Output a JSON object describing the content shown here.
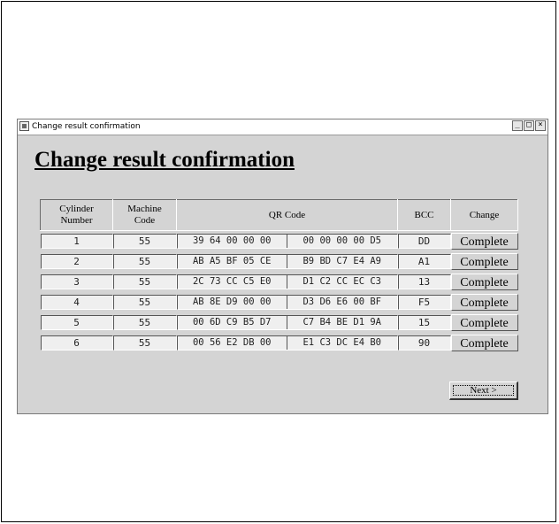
{
  "window": {
    "title": "Change result confirmation",
    "buttons": {
      "minimize": "_",
      "maximize": "□",
      "close": "×"
    }
  },
  "heading": "Change result confirmation",
  "table": {
    "headers": {
      "cylinder_line1": "Cylinder",
      "cylinder_line2": "Number",
      "machine_line1": "Machine",
      "machine_line2": "Code",
      "qr": "QR Code",
      "bcc": "BCC",
      "change": "Change"
    },
    "rows": [
      {
        "cylinder": "1",
        "machine": "55",
        "qr_left": "39 64 00 00 00",
        "qr_right": "00 00 00 00 D5",
        "bcc": "DD",
        "change": "Complete"
      },
      {
        "cylinder": "2",
        "machine": "55",
        "qr_left": "AB A5 BF 05 CE",
        "qr_right": "B9 BD C7 E4 A9",
        "bcc": "A1",
        "change": "Complete"
      },
      {
        "cylinder": "3",
        "machine": "55",
        "qr_left": "2C 73 CC C5 E0",
        "qr_right": "D1 C2 CC EC C3",
        "bcc": "13",
        "change": "Complete"
      },
      {
        "cylinder": "4",
        "machine": "55",
        "qr_left": "AB 8E D9 00 00",
        "qr_right": "D3 D6 E6 00 BF",
        "bcc": "F5",
        "change": "Complete"
      },
      {
        "cylinder": "5",
        "machine": "55",
        "qr_left": "00 6D C9 B5 D7",
        "qr_right": "C7 B4 BE D1 9A",
        "bcc": "15",
        "change": "Complete"
      },
      {
        "cylinder": "6",
        "machine": "55",
        "qr_left": "00 56 E2 DB 00",
        "qr_right": "E1 C3 DC E4 B0",
        "bcc": "90",
        "change": "Complete"
      }
    ]
  },
  "next_button": "Next >"
}
